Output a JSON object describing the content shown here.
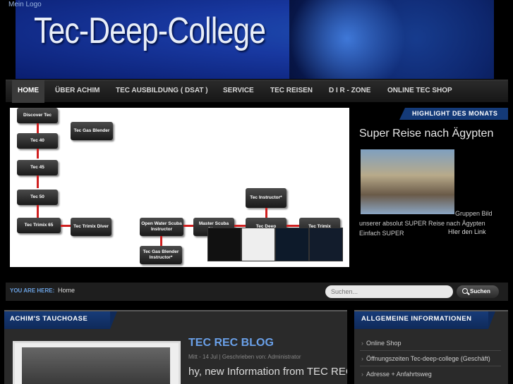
{
  "header": {
    "logo_alt": "Mein Logo",
    "title": "Tec-Deep-College"
  },
  "nav": {
    "items": [
      {
        "label": "HOME",
        "active": true
      },
      {
        "label": "ÜBER ACHIM"
      },
      {
        "label": "TEC AUSBILDUNG ( DSAT )"
      },
      {
        "label": "SERVICE"
      },
      {
        "label": "TEC REISEN"
      },
      {
        "label": "D I R - ZONE"
      },
      {
        "label": "ONLINE TEC SHOP"
      }
    ]
  },
  "slide": {
    "boxes": [
      "Discover Tec",
      "Tec 40",
      "Tec 45",
      "Tec 50",
      "Tec Trimix 65",
      "Tec Gas Blender",
      "Tec Trimix Diver",
      "Open Water Scuba Instructor",
      "Master Scuba Diver",
      "Tec Deep",
      "Tec Trimix",
      "Tec Instructor*",
      "Tec Gas Blender Instructor*"
    ]
  },
  "highlight": {
    "tab": "HIGHLIGHT DES MONATS",
    "title": "Super Reise nach Ägypten",
    "caption": "Gruppen Bild",
    "text": "unserer absolut SUPER  Reise nach Ägypten  Einfach SUPER",
    "link": "HIer den Link"
  },
  "breadcrumb": {
    "label": "YOU ARE HERE:",
    "current": "Home"
  },
  "search": {
    "placeholder": "Suchen...",
    "button": "Suchen"
  },
  "left_panel": {
    "tab": "ACHIM'S TAUCHOASE",
    "post": {
      "title": "TEC REC BLOG",
      "meta": "Mitt - 14 Jul  |  Geschrieben von: Administrator",
      "body": "hy, new Information from TEC REC,"
    }
  },
  "right_panel": {
    "tab": "ALLGEMEINE INFORMATIONEN",
    "items": [
      "Online Shop",
      "Öffnungszeiten Tec-deep-college (Geschäft)",
      "Adresse + Anfahrtsweg"
    ]
  },
  "colors": {
    "accent": "#143a78",
    "link": "#6aa0e8",
    "background": "#000000"
  }
}
